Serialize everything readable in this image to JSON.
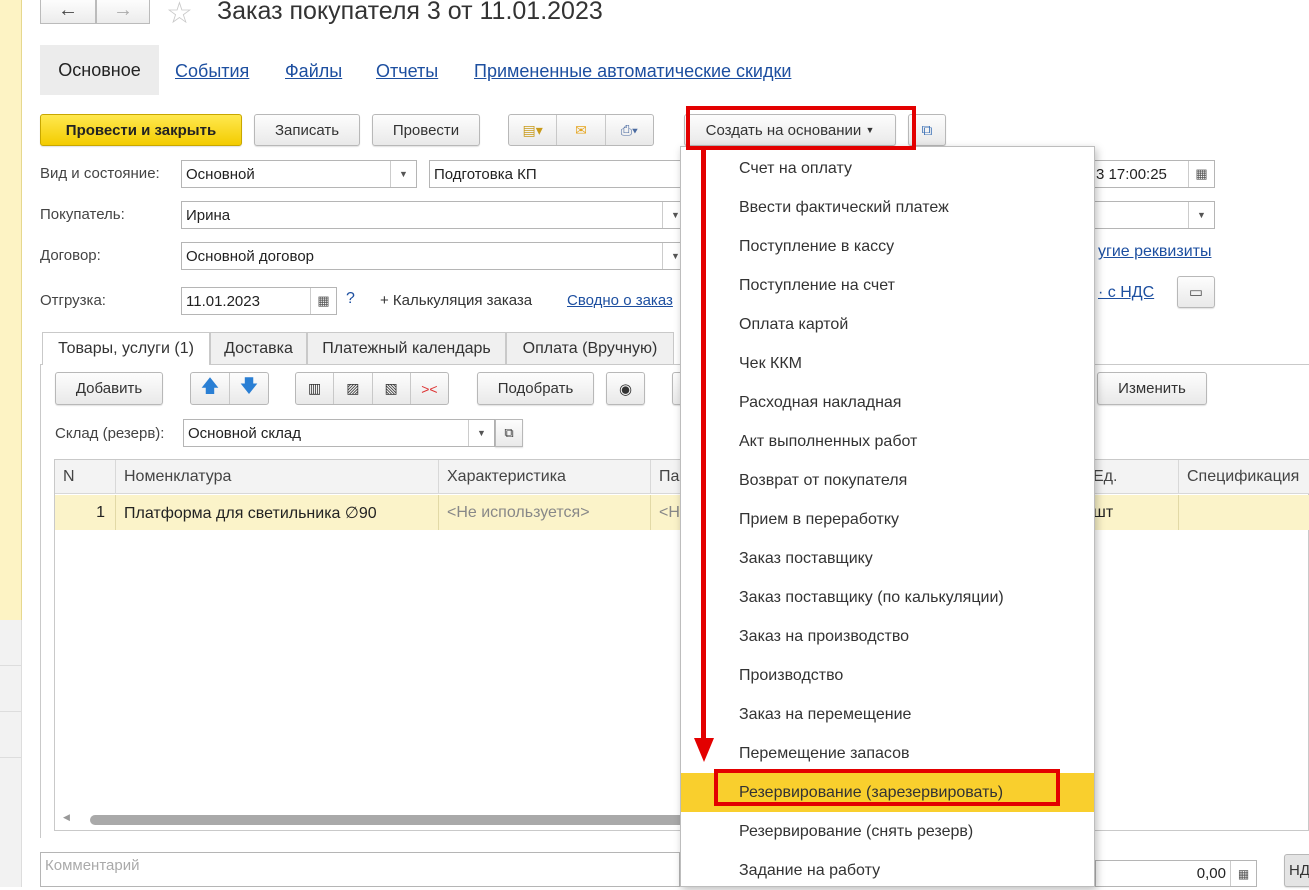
{
  "window": {
    "title": "Заказ покупателя 3 от 11.01.2023",
    "back_icon": "←",
    "forward_icon": "→",
    "star_icon": "☆"
  },
  "top_tabs": [
    "Основное",
    "События",
    "Файлы",
    "Отчеты",
    "Примененные автоматические скидки"
  ],
  "toolbar": {
    "post_close": "Провести и закрыть",
    "write": "Записать",
    "post": "Провести",
    "create_based": "Создать на основании"
  },
  "form": {
    "kind_label": "Вид и состояние:",
    "kind_value": "Основной",
    "state_value": "Подготовка КП",
    "date_value": "3 17:00:25",
    "buyer_label": "Покупатель:",
    "buyer_value": "Ирина",
    "contract_label": "Договор:",
    "contract_value": "Основной договор",
    "shipment_label": "Отгрузка:",
    "shipment_date": "11.01.2023",
    "help": "?",
    "calc": "+ Калькуляция заказа",
    "summary_link": "Сводно о заказ",
    "other_req_link": "угие реквизиты",
    "vat_link": "· с НДС"
  },
  "sub_tabs": [
    "Товары, услуги (1)",
    "Доставка",
    "Платежный календарь",
    "Оплата (Вручную)"
  ],
  "table_toolbar": {
    "add": "Добавить",
    "pick": "Подобрать",
    "change": "Изменить"
  },
  "warehouse": {
    "label": "Склад (резерв):",
    "value": "Основной склад"
  },
  "table": {
    "headers": [
      "N",
      "Номенклатура",
      "Характеристика",
      "Па",
      "Ед.",
      "Спецификация"
    ],
    "rows": [
      {
        "n": "1",
        "item": "Платформа для светильника ∅90",
        "char": "<Не используется>",
        "pa": "<Н",
        "unit": "шт",
        "spec": ""
      }
    ]
  },
  "comment_placeholder": "Комментарий",
  "total": "0,00",
  "nds_btn": "НД",
  "menu": {
    "items": [
      "Счет на оплату",
      "Ввести фактический платеж",
      "Поступление в кассу",
      "Поступление на счет",
      "Оплата картой",
      "Чек ККМ",
      "Расходная накладная",
      "Акт выполненных работ",
      "Возврат от покупателя",
      "Прием в переработку",
      "Заказ поставщику",
      "Заказ поставщику (по калькуляции)",
      "Заказ на производство",
      "Производство",
      "Заказ на перемещение",
      "Перемещение запасов",
      "Резервирование (зарезервировать)",
      "Резервирование (снять резерв)",
      "Задание на работу"
    ],
    "selected_index": 16
  },
  "colors": {
    "accent_yellow": "#f3cc00",
    "highlight": "#f9cf2d",
    "link": "#1d4fa0",
    "annotation_red": "#e30000"
  }
}
